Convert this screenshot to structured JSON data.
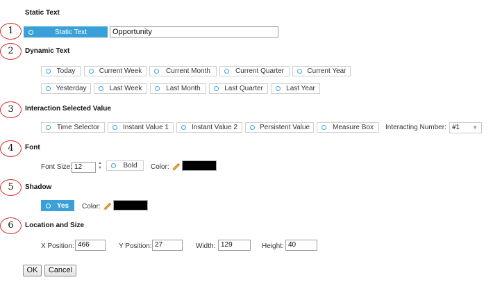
{
  "sections": {
    "static_text": {
      "step": "",
      "title": "Static Text"
    },
    "dynamic_text": {
      "step": "2",
      "title": "Dynamic Text"
    },
    "interaction": {
      "step": "3",
      "title": "Interaction Selected Value"
    },
    "font": {
      "step": "4",
      "title": "Font"
    },
    "shadow": {
      "step": "5",
      "title": "Shadow"
    },
    "location": {
      "step": "6",
      "title": "Location and Size"
    }
  },
  "step1": "1",
  "static_text": {
    "option_label": "Static Text",
    "value": "Opportunity"
  },
  "dynamic_text": {
    "row1": [
      "Today",
      "Current Week",
      "Current Month",
      "Current Quarter",
      "Current Year"
    ],
    "row2": [
      "Yesterday",
      "Last Week",
      "Last Month",
      "Last Quarter",
      "Last Year"
    ]
  },
  "interaction": {
    "options": [
      "Time Selector",
      "Instant Value 1",
      "Instant Value 2",
      "Persistent Value",
      "Measure Box"
    ],
    "number_label": "Interacting Number:",
    "number_value": "#1"
  },
  "font": {
    "size_label": "Font Size:",
    "size_value": "12",
    "bold_label": "Bold",
    "color_label": "Color:",
    "color": "#000000"
  },
  "shadow": {
    "yes_label": "Yes",
    "color_label": "Color:",
    "color": "#000000"
  },
  "location": {
    "x_label": "X Position:",
    "x_value": "466",
    "y_label": "Y Position:",
    "y_value": "27",
    "w_label": "Width:",
    "w_value": "129",
    "h_label": "Height:",
    "h_value": "40"
  },
  "buttons": {
    "ok": "OK",
    "cancel": "Cancel"
  },
  "icons": {
    "pencil": "pencil-icon",
    "spinner": "spinner-arrows-icon",
    "dropdown": "chevron-down-icon",
    "radio": "radio-icon"
  }
}
